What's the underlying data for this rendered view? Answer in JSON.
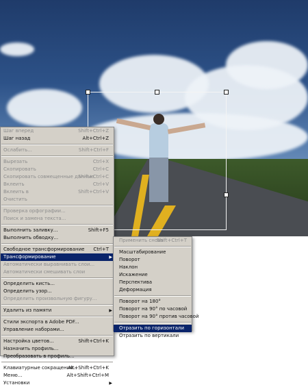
{
  "edit_menu": {
    "items": [
      {
        "label": "Шаг вперед",
        "shortcut": "Shift+Ctrl+Z",
        "disabled": true
      },
      {
        "label": "Шаг назад",
        "shortcut": "Alt+Ctrl+Z",
        "disabled": false
      },
      {
        "sep": true
      },
      {
        "label": "Ослабить...",
        "shortcut": "Shift+Ctrl+F",
        "disabled": true
      },
      {
        "sep": true
      },
      {
        "label": "Вырезать",
        "shortcut": "Ctrl+X",
        "disabled": true
      },
      {
        "label": "Скопировать",
        "shortcut": "Ctrl+C",
        "disabled": true
      },
      {
        "label": "Скопировать совмещенные данные",
        "shortcut": "Shift+Ctrl+C",
        "disabled": true
      },
      {
        "label": "Вклеить",
        "shortcut": "Ctrl+V",
        "disabled": true
      },
      {
        "label": "Вклеить в",
        "shortcut": "Shift+Ctrl+V",
        "disabled": true
      },
      {
        "label": "Очистить",
        "shortcut": "",
        "disabled": true
      },
      {
        "sep": true
      },
      {
        "label": "Проверка орфографии...",
        "shortcut": "",
        "disabled": true
      },
      {
        "label": "Поиск и замена текста...",
        "shortcut": "",
        "disabled": true
      },
      {
        "sep": true
      },
      {
        "label": "Выполнить заливку...",
        "shortcut": "Shift+F5",
        "disabled": false
      },
      {
        "label": "Выполнить обводку...",
        "shortcut": "",
        "disabled": false
      },
      {
        "sep": true
      },
      {
        "label": "Свободное трансформирование",
        "shortcut": "Ctrl+T",
        "disabled": false
      },
      {
        "label": "Трансформирование",
        "shortcut": "",
        "disabled": false,
        "highlight": true,
        "submenu": true
      },
      {
        "label": "Автоматически выравнивать слои...",
        "shortcut": "",
        "disabled": true
      },
      {
        "label": "Автоматически смешивать слои",
        "shortcut": "",
        "disabled": true
      },
      {
        "sep": true
      },
      {
        "label": "Определить кисть...",
        "shortcut": "",
        "disabled": false
      },
      {
        "label": "Определить узор...",
        "shortcut": "",
        "disabled": false
      },
      {
        "label": "Определить произвольную фигуру...",
        "shortcut": "",
        "disabled": true
      },
      {
        "sep": true
      },
      {
        "label": "Удалить из памяти",
        "shortcut": "",
        "disabled": false,
        "submenu": true
      },
      {
        "sep": true
      },
      {
        "label": "Стили экспорта в Adobe PDF...",
        "shortcut": "",
        "disabled": false
      },
      {
        "label": "Управление наборами...",
        "shortcut": "",
        "disabled": false
      },
      {
        "sep": true
      },
      {
        "label": "Настройка цветов...",
        "shortcut": "Shift+Ctrl+K",
        "disabled": false
      },
      {
        "label": "Назначить профиль...",
        "shortcut": "",
        "disabled": false
      },
      {
        "label": "Преобразовать в профиль...",
        "shortcut": "",
        "disabled": false
      },
      {
        "sep": true
      },
      {
        "label": "Клавиатурные сокращения...",
        "shortcut": "Alt+Shift+Ctrl+K",
        "disabled": false
      },
      {
        "label": "Меню...",
        "shortcut": "Alt+Shift+Ctrl+M",
        "disabled": false
      },
      {
        "label": "Установки",
        "shortcut": "",
        "disabled": false,
        "submenu": true
      }
    ]
  },
  "transform_submenu": {
    "items": [
      {
        "label": "Применить снова",
        "shortcut": "Shift+Ctrl+T",
        "disabled": true
      },
      {
        "sep": true
      },
      {
        "label": "Масштабирование",
        "shortcut": "",
        "disabled": false
      },
      {
        "label": "Поворот",
        "shortcut": "",
        "disabled": false
      },
      {
        "label": "Наклон",
        "shortcut": "",
        "disabled": false
      },
      {
        "label": "Искажение",
        "shortcut": "",
        "disabled": false
      },
      {
        "label": "Перспектива",
        "shortcut": "",
        "disabled": false
      },
      {
        "label": "Деформация",
        "shortcut": "",
        "disabled": false
      },
      {
        "sep": true
      },
      {
        "label": "Поворот на 180°",
        "shortcut": "",
        "disabled": false
      },
      {
        "label": "Поворот на 90° по часовой",
        "shortcut": "",
        "disabled": false
      },
      {
        "label": "Поворот на 90° против часовой",
        "shortcut": "",
        "disabled": false
      },
      {
        "sep": true
      },
      {
        "label": "Отразить по горизонтали",
        "shortcut": "",
        "disabled": false,
        "highlight": true
      },
      {
        "label": "Отразить по вертикали",
        "shortcut": "",
        "disabled": false
      }
    ]
  },
  "colors": {
    "menu_bg": "#d4d0c8",
    "highlight": "#0a246a",
    "disabled_text": "#8d8d8d"
  }
}
